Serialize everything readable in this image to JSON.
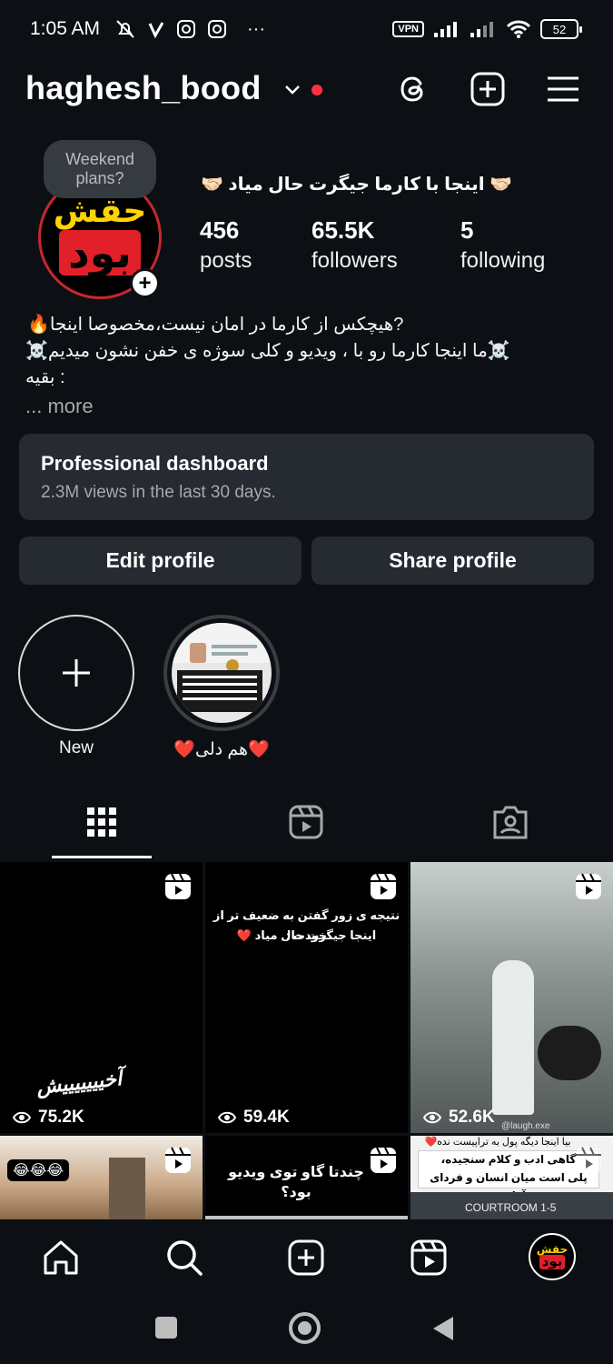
{
  "status_bar": {
    "time": "1:05 AM",
    "vpn": "VPN",
    "battery": "52",
    "more": "···"
  },
  "header": {
    "username": "haghesh_bood"
  },
  "profile": {
    "note": "Weekend plans?",
    "avatar_text_top": "حقش",
    "avatar_text_bottom": "بود",
    "full_name": "🤝🏻 اینجا با کارما جیگرت حال میاد 🤝🏻",
    "stats": {
      "posts": {
        "value": "456",
        "label": "posts"
      },
      "followers": {
        "value": "65.5K",
        "label": "followers"
      },
      "following": {
        "value": "5",
        "label": "following"
      }
    },
    "bio": {
      "line1": "🔥هیچکس از کارما در امان نیست،مخصوصا اینجا?",
      "line2": "☠️ما اینجا کارما رو با ، ویدیو و کلی سوژه ی خفن نشون میدیم☠️",
      "line3": "بقیه :",
      "more": "... more"
    }
  },
  "dashboard": {
    "title": "Professional dashboard",
    "subtitle": "2.3M views in the last 30 days."
  },
  "buttons": {
    "edit": "Edit profile",
    "share": "Share profile"
  },
  "highlights": [
    {
      "label": "New"
    },
    {
      "label": "❤️هم دلی❤️"
    }
  ],
  "grid": [
    {
      "views": "75.2K",
      "overlay": "آخیییییییش"
    },
    {
      "views": "59.4K",
      "overlay_line1": "نتیجه ی زور گفتن به ضعیف تر از خودت :",
      "overlay_line2": "اینجا جیگرت حال میاد ❤️"
    },
    {
      "views": "52.6K",
      "watermark": "@laugh.exe"
    },
    {
      "overlay": "😂😂😂"
    },
    {
      "overlay": "چندتا گاو توی ویدیو بود؟"
    },
    {
      "overlay_line1": "بیا اینجا دیگه پول به تراپیست نده❤️",
      "overlay_line2": "گاهی ادب و کلام سنجیده،",
      "overlay_line3": "پلی است میان انسان و فردای آزادش",
      "caption": "COURTROOM 1-5"
    }
  ]
}
